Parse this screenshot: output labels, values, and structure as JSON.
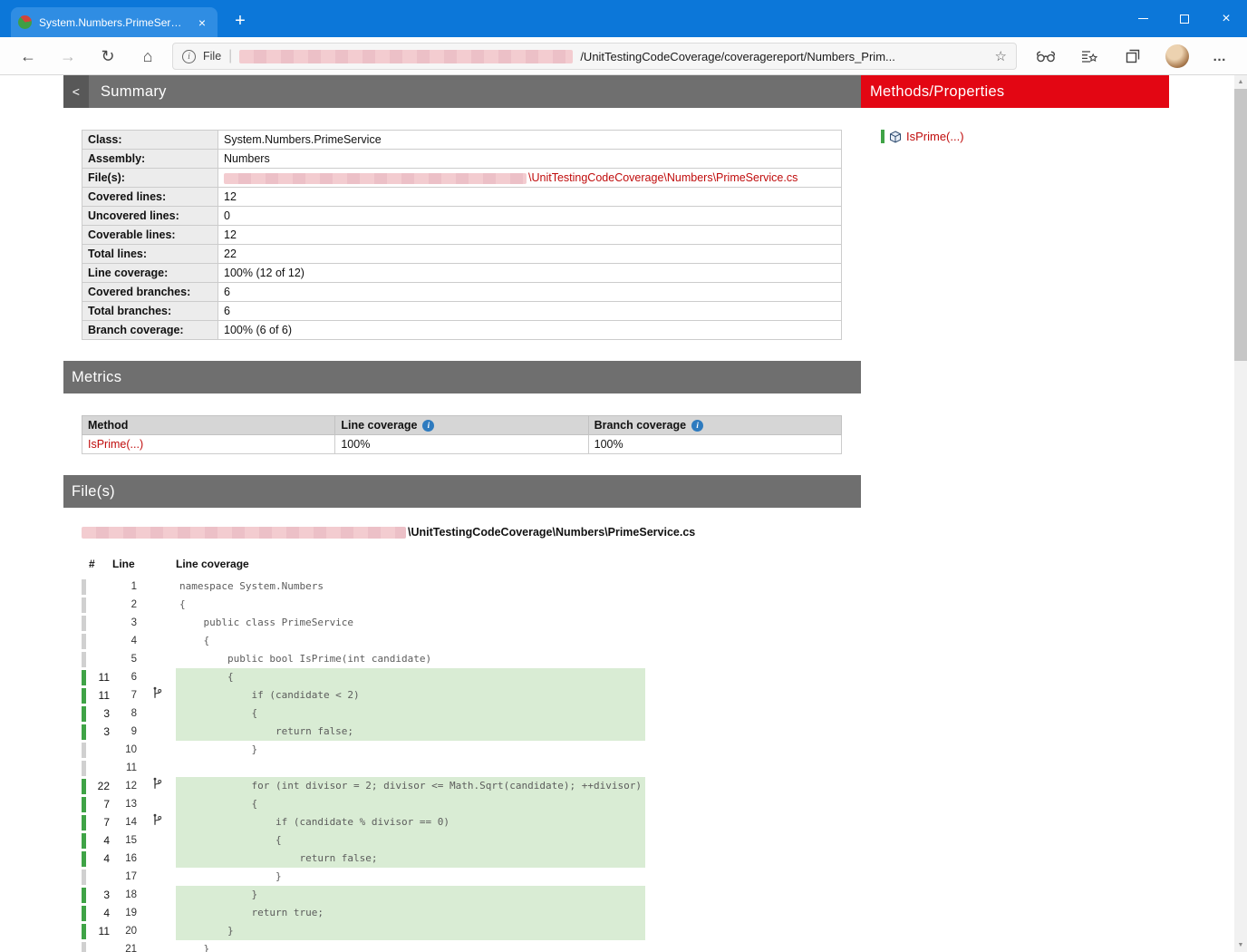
{
  "colors": {
    "titlebar_blue": "#0c77d9",
    "header_gray": "#6f6f6f",
    "accent_red": "#e30613",
    "link_red": "#c00c0c",
    "covered_bg": "#d9ecd4",
    "covered_indicator": "#3fa346",
    "noncoverable_indicator": "#d0d0d0"
  },
  "browser": {
    "tab_title": "System.Numbers.PrimeService -",
    "controls": {
      "close": "×",
      "tab_close": "×",
      "new_tab": "+"
    },
    "nav": {
      "back": "←",
      "forward": "→",
      "refresh": "↻",
      "home": "⌂"
    },
    "address": {
      "info": "i",
      "scheme": "File",
      "separator": "|",
      "visible_path": "/UnitTestingCodeCoverage/coveragereport/Numbers_Prim...",
      "bookmark_star": "☆"
    },
    "toolbar": {
      "more": "…"
    }
  },
  "summary": {
    "title": "Summary",
    "back_label": "<",
    "rows": [
      {
        "label": "Class:",
        "value": "System.Numbers.PrimeService"
      },
      {
        "label": "Assembly:",
        "value": "Numbers"
      },
      {
        "label": "File(s):",
        "redacted": true,
        "link": true,
        "value": "\\UnitTestingCodeCoverage\\Numbers\\PrimeService.cs"
      },
      {
        "label": "Covered lines:",
        "value": "12"
      },
      {
        "label": "Uncovered lines:",
        "value": "0"
      },
      {
        "label": "Coverable lines:",
        "value": "12"
      },
      {
        "label": "Total lines:",
        "value": "22"
      },
      {
        "label": "Line coverage:",
        "value": "100% (12 of 12)"
      },
      {
        "label": "Covered branches:",
        "value": "6"
      },
      {
        "label": "Total branches:",
        "value": "6"
      },
      {
        "label": "Branch coverage:",
        "value": "100% (6 of 6)"
      }
    ]
  },
  "metrics": {
    "title": "Metrics",
    "headers": [
      {
        "label": "Method",
        "info": false
      },
      {
        "label": "Line coverage",
        "info": true
      },
      {
        "label": "Branch coverage",
        "info": true
      }
    ],
    "rows": [
      {
        "method": "IsPrime(...)",
        "line_coverage": "100%",
        "branch_coverage": "100%"
      }
    ]
  },
  "files": {
    "title": "File(s)",
    "path_suffix": "\\UnitTestingCodeCoverage\\Numbers\\PrimeService.cs",
    "table_headers": {
      "hash": "#",
      "line": "Line",
      "coverage": "Line coverage"
    },
    "lines": [
      {
        "n": 1,
        "hits": "",
        "covered": false,
        "branch": false,
        "code": "namespace System.Numbers"
      },
      {
        "n": 2,
        "hits": "",
        "covered": false,
        "branch": false,
        "code": "{"
      },
      {
        "n": 3,
        "hits": "",
        "covered": false,
        "branch": false,
        "code": "    public class PrimeService"
      },
      {
        "n": 4,
        "hits": "",
        "covered": false,
        "branch": false,
        "code": "    {"
      },
      {
        "n": 5,
        "hits": "",
        "covered": false,
        "branch": false,
        "code": "        public bool IsPrime(int candidate)"
      },
      {
        "n": 6,
        "hits": "11",
        "covered": true,
        "branch": false,
        "code": "        {"
      },
      {
        "n": 7,
        "hits": "11",
        "covered": true,
        "branch": true,
        "code": "            if (candidate < 2)"
      },
      {
        "n": 8,
        "hits": "3",
        "covered": true,
        "branch": false,
        "code": "            {"
      },
      {
        "n": 9,
        "hits": "3",
        "covered": true,
        "branch": false,
        "code": "                return false;"
      },
      {
        "n": 10,
        "hits": "",
        "covered": false,
        "branch": false,
        "code": "            }"
      },
      {
        "n": 11,
        "hits": "",
        "covered": false,
        "branch": false,
        "code": ""
      },
      {
        "n": 12,
        "hits": "22",
        "covered": true,
        "branch": true,
        "code": "            for (int divisor = 2; divisor <= Math.Sqrt(candidate); ++divisor)"
      },
      {
        "n": 13,
        "hits": "7",
        "covered": true,
        "branch": false,
        "code": "            {"
      },
      {
        "n": 14,
        "hits": "7",
        "covered": true,
        "branch": true,
        "code": "                if (candidate % divisor == 0)"
      },
      {
        "n": 15,
        "hits": "4",
        "covered": true,
        "branch": false,
        "code": "                {"
      },
      {
        "n": 16,
        "hits": "4",
        "covered": true,
        "branch": false,
        "code": "                    return false;"
      },
      {
        "n": 17,
        "hits": "",
        "covered": false,
        "branch": false,
        "code": "                }"
      },
      {
        "n": 18,
        "hits": "3",
        "covered": true,
        "branch": false,
        "code": "            }"
      },
      {
        "n": 19,
        "hits": "4",
        "covered": true,
        "branch": false,
        "code": "            return true;"
      },
      {
        "n": 20,
        "hits": "11",
        "covered": true,
        "branch": false,
        "code": "        }"
      },
      {
        "n": 21,
        "hits": "",
        "covered": false,
        "branch": false,
        "code": "    }"
      }
    ]
  },
  "methods_panel": {
    "title": "Methods/Properties",
    "items": [
      {
        "label": "IsPrime(...)"
      }
    ]
  }
}
